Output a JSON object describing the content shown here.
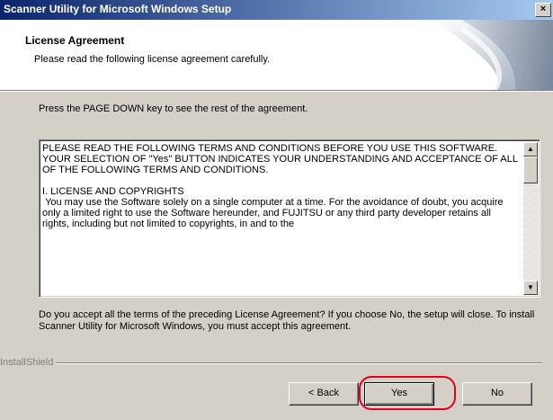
{
  "window": {
    "title": "Scanner Utility for Microsoft Windows Setup",
    "close_label": "×"
  },
  "header": {
    "title": "License Agreement",
    "subtitle": "Please read the following license agreement carefully."
  },
  "instruction": "Press the PAGE DOWN key to see the rest of the agreement.",
  "license": {
    "paragraphs": [
      "PLEASE READ THE FOLLOWING TERMS AND CONDITIONS BEFORE YOU USE THIS SOFTWARE. YOUR SELECTION OF \"Yes\" BUTTON INDICATES YOUR UNDERSTANDING AND ACCEPTANCE OF ALL OF THE FOLLOWING TERMS AND CONDITIONS.",
      "I. LICENSE AND COPYRIGHTS",
      " You may use the Software solely on a single computer at a time. For the avoidance of doubt, you acquire only a limited right to use the Software hereunder, and FUJITSU or any third party developer retains all rights, including but not limited to copyrights, in and to the"
    ]
  },
  "question": "Do you accept all the terms of the preceding License Agreement?  If you choose No,  the setup will close.  To install Scanner Utility for Microsoft Windows, you must accept this agreement.",
  "installshield_label": "InstallShield",
  "buttons": {
    "back_label": "< Back",
    "yes_label": "Yes",
    "no_label": "No"
  },
  "colors": {
    "highlight": "#e0001a",
    "title_start": "#0a246a",
    "title_end": "#a6caf0"
  }
}
